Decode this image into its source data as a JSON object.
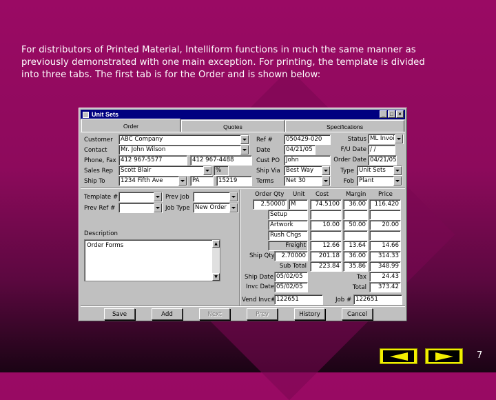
{
  "intro": {
    "line1": "For distributors of Printed Material, Intelliform functions in much the same manner as",
    "line2": "previously demonstrated with one main exception.  For printing, the template is divided",
    "line3": "into three tabs. The first tab is for the Order and is shown below:"
  },
  "window": {
    "title": "Unit Sets"
  },
  "tabs": [
    "Order",
    "Quotes",
    "Specifications"
  ],
  "labels": {
    "customer": "Customer",
    "contact": "Contact",
    "phone_fax": "Phone, Fax",
    "sales_rep": "Sales Rep",
    "ship_to": "Ship To",
    "ref": "Ref #",
    "date": "Date",
    "cust_po": "Cust PO",
    "ship_via": "Ship Via",
    "terms": "Terms",
    "status": "Status",
    "fu_date": "F/U Date",
    "order_date": "Order Date",
    "type": "Type",
    "fob": "Fob",
    "template": "Template #",
    "prev_ref": "Prev Ref #",
    "prev_job": "Prev Job",
    "job_type": "Job Type",
    "description": "Description",
    "order_qty": "Order Qty",
    "unit": "Unit",
    "cost": "Cost",
    "margin": "Margin",
    "price": "Price",
    "ship_qty": "Ship Qty",
    "ship_date": "Ship Date",
    "invc_date": "Invc Date",
    "vend_invc": "Vend Invc#",
    "job_no": "Job #",
    "sub_total": "Sub Total",
    "tax": "Tax",
    "total": "Total"
  },
  "fields": {
    "customer": "ABC Company",
    "contact": "Mr. John Wilson",
    "phone": "412 967-5577",
    "fax": "412 967-4488",
    "sales_rep": "Scott Blair",
    "pct": "%",
    "address": "1234 Fifth Ave",
    "state": "PA",
    "zip": "15219",
    "ref": "050429-020",
    "date": "04/21/05",
    "cust_po": "John",
    "ship_via": "Best Way",
    "terms": "Net 30",
    "status": "ML Invoic",
    "fu_date": " / /",
    "order_date": "04/21/05",
    "type": "Unit Sets",
    "fob": "Plant",
    "template": "",
    "prev_ref": "",
    "prev_job": "",
    "job_type": "New Order",
    "description": "Order Forms",
    "order_qty": "2.50000",
    "unit": "M",
    "cost": "74.5100",
    "margin": "36.00",
    "price": "116.420",
    "ship_qty": "2.70000",
    "ship_date": "05/02/05",
    "invc_date": "05/02/05",
    "vend_invc": "122651",
    "job_no": "122651"
  },
  "line_items": [
    {
      "name": "Setup",
      "cost": "",
      "margin": "",
      "price": ""
    },
    {
      "name": "Artwork",
      "cost": "10.00",
      "margin": "50.00",
      "price": "20.00"
    },
    {
      "name": "Rush Chgs",
      "cost": "",
      "margin": "",
      "price": ""
    }
  ],
  "freight": {
    "label": "Freight",
    "cost": "12.66",
    "margin": "13.64",
    "price": "14.66"
  },
  "ship_row": {
    "cost": "201.18",
    "margin": "36.00",
    "price": "314.33"
  },
  "subtotal_row": {
    "cost": "223.84",
    "margin": "35.86",
    "price": "348.99"
  },
  "tax_value": "24.43",
  "total_value": "373.42",
  "buttons": [
    "Save",
    "Add",
    "Next",
    "Prev",
    "History",
    "Cancel"
  ],
  "page_number": "7",
  "colors": {
    "background": "#8d0a5c",
    "title_bar": "#000080",
    "nav_button": "#f2ef00"
  }
}
